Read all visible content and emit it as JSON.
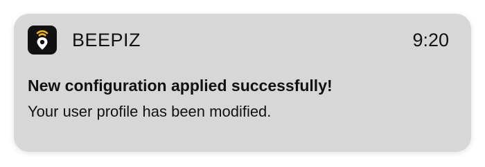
{
  "notification": {
    "app_icon": "beepiz-location-pin-icon",
    "app_name": "BEEPIZ",
    "time": "9:20",
    "title": "New configuration applied successfully!",
    "body": "Your user profile has been modified."
  },
  "colors": {
    "card_background": "#d7d7d7",
    "icon_background": "#111111",
    "icon_accent": "#f2b705",
    "text": "#111111"
  }
}
